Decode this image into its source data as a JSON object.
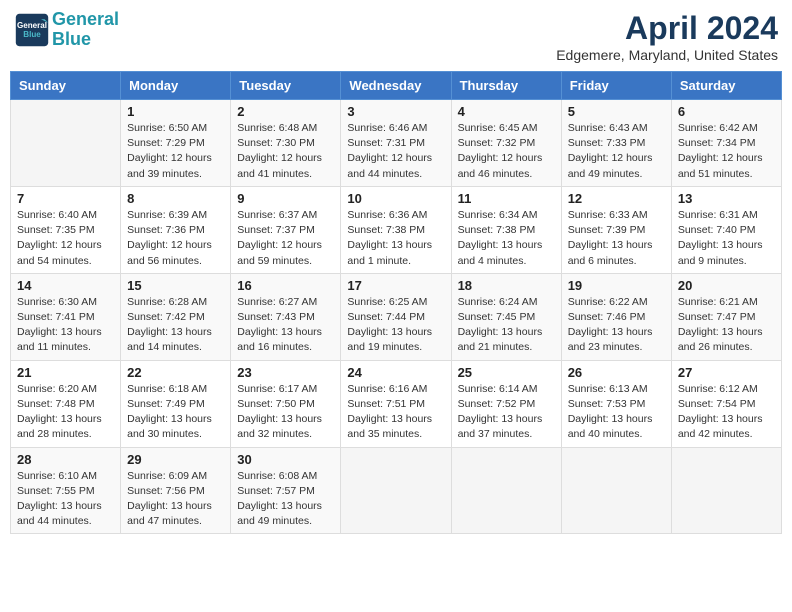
{
  "header": {
    "logo_line1": "General",
    "logo_line2": "Blue",
    "month": "April 2024",
    "location": "Edgemere, Maryland, United States"
  },
  "weekdays": [
    "Sunday",
    "Monday",
    "Tuesday",
    "Wednesday",
    "Thursday",
    "Friday",
    "Saturday"
  ],
  "weeks": [
    [
      {
        "day": "",
        "info": ""
      },
      {
        "day": "1",
        "info": "Sunrise: 6:50 AM\nSunset: 7:29 PM\nDaylight: 12 hours\nand 39 minutes."
      },
      {
        "day": "2",
        "info": "Sunrise: 6:48 AM\nSunset: 7:30 PM\nDaylight: 12 hours\nand 41 minutes."
      },
      {
        "day": "3",
        "info": "Sunrise: 6:46 AM\nSunset: 7:31 PM\nDaylight: 12 hours\nand 44 minutes."
      },
      {
        "day": "4",
        "info": "Sunrise: 6:45 AM\nSunset: 7:32 PM\nDaylight: 12 hours\nand 46 minutes."
      },
      {
        "day": "5",
        "info": "Sunrise: 6:43 AM\nSunset: 7:33 PM\nDaylight: 12 hours\nand 49 minutes."
      },
      {
        "day": "6",
        "info": "Sunrise: 6:42 AM\nSunset: 7:34 PM\nDaylight: 12 hours\nand 51 minutes."
      }
    ],
    [
      {
        "day": "7",
        "info": "Sunrise: 6:40 AM\nSunset: 7:35 PM\nDaylight: 12 hours\nand 54 minutes."
      },
      {
        "day": "8",
        "info": "Sunrise: 6:39 AM\nSunset: 7:36 PM\nDaylight: 12 hours\nand 56 minutes."
      },
      {
        "day": "9",
        "info": "Sunrise: 6:37 AM\nSunset: 7:37 PM\nDaylight: 12 hours\nand 59 minutes."
      },
      {
        "day": "10",
        "info": "Sunrise: 6:36 AM\nSunset: 7:38 PM\nDaylight: 13 hours\nand 1 minute."
      },
      {
        "day": "11",
        "info": "Sunrise: 6:34 AM\nSunset: 7:38 PM\nDaylight: 13 hours\nand 4 minutes."
      },
      {
        "day": "12",
        "info": "Sunrise: 6:33 AM\nSunset: 7:39 PM\nDaylight: 13 hours\nand 6 minutes."
      },
      {
        "day": "13",
        "info": "Sunrise: 6:31 AM\nSunset: 7:40 PM\nDaylight: 13 hours\nand 9 minutes."
      }
    ],
    [
      {
        "day": "14",
        "info": "Sunrise: 6:30 AM\nSunset: 7:41 PM\nDaylight: 13 hours\nand 11 minutes."
      },
      {
        "day": "15",
        "info": "Sunrise: 6:28 AM\nSunset: 7:42 PM\nDaylight: 13 hours\nand 14 minutes."
      },
      {
        "day": "16",
        "info": "Sunrise: 6:27 AM\nSunset: 7:43 PM\nDaylight: 13 hours\nand 16 minutes."
      },
      {
        "day": "17",
        "info": "Sunrise: 6:25 AM\nSunset: 7:44 PM\nDaylight: 13 hours\nand 19 minutes."
      },
      {
        "day": "18",
        "info": "Sunrise: 6:24 AM\nSunset: 7:45 PM\nDaylight: 13 hours\nand 21 minutes."
      },
      {
        "day": "19",
        "info": "Sunrise: 6:22 AM\nSunset: 7:46 PM\nDaylight: 13 hours\nand 23 minutes."
      },
      {
        "day": "20",
        "info": "Sunrise: 6:21 AM\nSunset: 7:47 PM\nDaylight: 13 hours\nand 26 minutes."
      }
    ],
    [
      {
        "day": "21",
        "info": "Sunrise: 6:20 AM\nSunset: 7:48 PM\nDaylight: 13 hours\nand 28 minutes."
      },
      {
        "day": "22",
        "info": "Sunrise: 6:18 AM\nSunset: 7:49 PM\nDaylight: 13 hours\nand 30 minutes."
      },
      {
        "day": "23",
        "info": "Sunrise: 6:17 AM\nSunset: 7:50 PM\nDaylight: 13 hours\nand 32 minutes."
      },
      {
        "day": "24",
        "info": "Sunrise: 6:16 AM\nSunset: 7:51 PM\nDaylight: 13 hours\nand 35 minutes."
      },
      {
        "day": "25",
        "info": "Sunrise: 6:14 AM\nSunset: 7:52 PM\nDaylight: 13 hours\nand 37 minutes."
      },
      {
        "day": "26",
        "info": "Sunrise: 6:13 AM\nSunset: 7:53 PM\nDaylight: 13 hours\nand 40 minutes."
      },
      {
        "day": "27",
        "info": "Sunrise: 6:12 AM\nSunset: 7:54 PM\nDaylight: 13 hours\nand 42 minutes."
      }
    ],
    [
      {
        "day": "28",
        "info": "Sunrise: 6:10 AM\nSunset: 7:55 PM\nDaylight: 13 hours\nand 44 minutes."
      },
      {
        "day": "29",
        "info": "Sunrise: 6:09 AM\nSunset: 7:56 PM\nDaylight: 13 hours\nand 47 minutes."
      },
      {
        "day": "30",
        "info": "Sunrise: 6:08 AM\nSunset: 7:57 PM\nDaylight: 13 hours\nand 49 minutes."
      },
      {
        "day": "",
        "info": ""
      },
      {
        "day": "",
        "info": ""
      },
      {
        "day": "",
        "info": ""
      },
      {
        "day": "",
        "info": ""
      }
    ]
  ]
}
